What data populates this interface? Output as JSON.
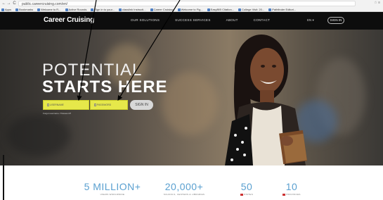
{
  "browser": {
    "url": "public.careercruising.com/en/",
    "nav_back": "←",
    "nav_forward": "→",
    "nav_reload": "C",
    "bookmarks": [
      "Apps",
      "Bookmarks",
      "Welcome to R...",
      "Active Rounds",
      "Sign in to your...",
      "classlink Instructi...",
      "Career Cruising",
      "Welcome to Fig...",
      "EasyBIB Citation...",
      "College Visit: 20...",
      "Pathfinder Editori..."
    ]
  },
  "header": {
    "logo": "Career Cruising",
    "nav": [
      "OUR SOLUTIONS",
      "SUCCESS SERVICES",
      "ABOUT",
      "CONTACT"
    ],
    "lang": "EN ▾",
    "signin": "SIGN IN"
  },
  "hero": {
    "title_line1": "POTENTIAL",
    "title_line2": "STARTS HERE",
    "username_placeholder": "USERNAME",
    "password_placeholder": "PASSWORD",
    "signin_button": "SIGN IN",
    "forgot": "Forgot username / Password?"
  },
  "stats": [
    {
      "number": "5 MILLION+",
      "label": "USERS WORLDWIDE"
    },
    {
      "number": "20,000+",
      "label": "SCHOOLS, CENTERS & LIBRARIES"
    },
    {
      "number": "50",
      "label": "STATES"
    },
    {
      "number": "10",
      "label": "PROVINCES"
    }
  ],
  "colors": {
    "header_bg": "#0d0d0d",
    "login_field": "#e6e84a",
    "stat_number": "#5aa0d0"
  }
}
